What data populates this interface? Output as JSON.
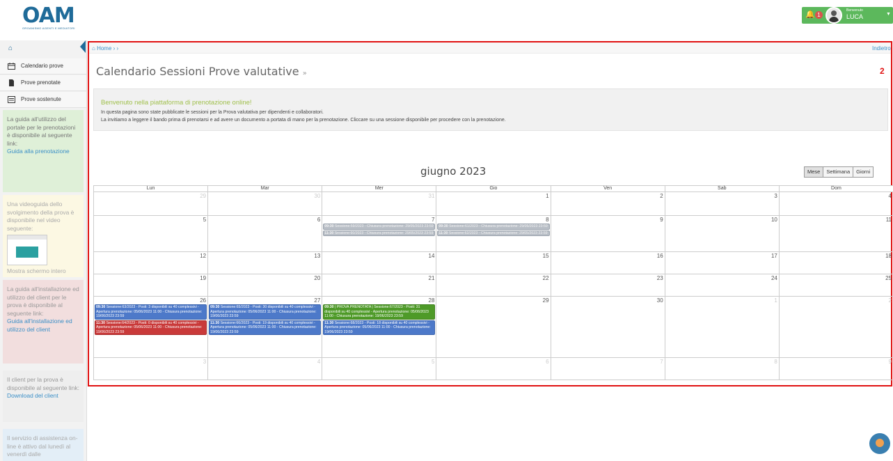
{
  "header": {
    "logo_text": "OAM",
    "logo_subtitle": "ORGANISMO AGENTI E MEDIATORI",
    "notification_count": "1",
    "welcome": "Benvenuto",
    "user_name": "LUCA"
  },
  "sidebar": {
    "items": [
      {
        "label": "Calendario prove"
      },
      {
        "label": "Prove prenotate"
      },
      {
        "label": "Prove sostenute"
      }
    ],
    "panels": {
      "guide_text": "La guida all'utilizzo del portale per le prenotazioni è disponibile al seguente link:",
      "guide_link": "Guida alla prenotazione",
      "video_text": "Una videoguida dello svolgimento della prova è disponibile nel video seguente:",
      "video_link": "Mostra schermo intero",
      "client_guide_text": "La guida all'installazione ed utilizzo del client per le prova è disponibile al seguente link:",
      "client_guide_link": "Guida all'installazione ed utilizzo del client",
      "download_text": "Il client per la prova è disponibile al seguente link:",
      "download_link": "Download del client",
      "assist_text": "Il servizio di assistenza on-line è attivo dal lunedì al venerdì dalle"
    }
  },
  "breadcrumb": {
    "home": "Home",
    "sep": "› ›",
    "back": "Indietro"
  },
  "page": {
    "title": "Calendario Sessioni Prove valutative",
    "title_suffix": "»",
    "marker": "2"
  },
  "info": {
    "heading": "Benvenuto nella piattaforma di prenotazione online!",
    "line1": "In questa pagina sono state pubblicate le sessioni per la Prova valutativa per dipendenti e collaboratori.",
    "line2": "La invitiamo a leggere il bando prima di prenotarsi e ad avere un documento a portata di mano per la prenotazione. Cliccare su una sessione disponibile per procedere con la prenotazione."
  },
  "calendar": {
    "month_label": "giugno 2023",
    "view_buttons": [
      "Mese",
      "Settimana",
      "Giorni"
    ],
    "weekdays": [
      "Lun",
      "Mar",
      "Mer",
      "Gio",
      "Ven",
      "Sab",
      "Dom"
    ],
    "weeks": [
      {
        "days": [
          {
            "n": "29",
            "muted": true,
            "events": []
          },
          {
            "n": "30",
            "muted": true,
            "events": []
          },
          {
            "n": "31",
            "muted": true,
            "events": []
          },
          {
            "n": "1",
            "events": []
          },
          {
            "n": "2",
            "events": []
          },
          {
            "n": "3",
            "events": []
          },
          {
            "n": "4",
            "events": []
          }
        ]
      },
      {
        "days": [
          {
            "n": "5",
            "events": []
          },
          {
            "n": "6",
            "events": []
          },
          {
            "n": "7",
            "events": [
              {
                "time": "09:30",
                "text": "Sessione:59/2023 - Chiusura prenotazione: 29/05/2023 23:59",
                "color": "gray"
              },
              {
                "time": "11:30",
                "text": "Sessione:60/2023 - Chiusura prenotazione: 29/05/2023 23:59",
                "color": "gray"
              }
            ]
          },
          {
            "n": "8",
            "events": [
              {
                "time": "09:30",
                "text": "Sessione:61/2023 - Chiusura prenotazione: 29/05/2023 23:59",
                "color": "gray"
              },
              {
                "time": "11:30",
                "text": "Sessione:62/2023 - Chiusura prenotazione: 29/05/2023 23:59",
                "color": "gray"
              }
            ]
          },
          {
            "n": "9",
            "events": []
          },
          {
            "n": "10",
            "events": []
          },
          {
            "n": "11",
            "events": []
          }
        ]
      },
      {
        "days": [
          {
            "n": "12",
            "events": []
          },
          {
            "n": "13",
            "events": []
          },
          {
            "n": "14",
            "events": []
          },
          {
            "n": "15",
            "events": []
          },
          {
            "n": "16",
            "events": []
          },
          {
            "n": "17",
            "events": []
          },
          {
            "n": "18",
            "events": []
          }
        ]
      },
      {
        "days": [
          {
            "n": "19",
            "events": []
          },
          {
            "n": "20",
            "events": []
          },
          {
            "n": "21",
            "events": []
          },
          {
            "n": "22",
            "events": []
          },
          {
            "n": "23",
            "events": []
          },
          {
            "n": "24",
            "events": []
          },
          {
            "n": "25",
            "events": []
          }
        ]
      },
      {
        "days": [
          {
            "n": "26",
            "events": [
              {
                "time": "09:30",
                "text": "Sessione:63/2023 - Posti: 3 disponibili su 40 complessivi - Apertura prenotazione: 05/06/2023 11:00 - Chiusura prenotazione: 19/06/2023 23:59",
                "color": "blue"
              },
              {
                "time": "11:30",
                "text": "Sessione:64/2023 - Posti: 0 disponibili su 40 complessivi - Apertura prenotazione: 05/06/2023 11:00 - Chiusura prenotazione: 19/06/2023 23:59",
                "color": "red"
              }
            ]
          },
          {
            "n": "27",
            "events": [
              {
                "time": "09:30",
                "text": "Sessione:65/2023 - Posti: 30 disponibili su 40 complessivi - Apertura prenotazione: 05/06/2023 11:00 - Chiusura prenotazione: 19/06/2023 23:59",
                "color": "blue"
              },
              {
                "time": "11:30",
                "text": "Sessione:66/2023 - Posti: 19 disponibili su 40 complessivi - Apertura prenotazione: 05/06/2023 11:00 - Chiusura prenotazione: 19/06/2023 23:59",
                "color": "blue"
              }
            ]
          },
          {
            "n": "28",
            "events": [
              {
                "time": "09:30",
                "text": "| PROVA PRENOTATA | Sessione:67/2023 - Posti: 31 disponibili su 40 complessivi - Apertura prenotazione: 05/06/2023 11:00 - Chiusura prenotazione: 19/06/2023 23:59",
                "color": "green"
              },
              {
                "time": "11:30",
                "text": "Sessione:68/2023 - Posti: 18 disponibili su 40 complessivi - Apertura prenotazione: 05/06/2023 11:00 - Chiusura prenotazione: 19/06/2023 23:59",
                "color": "blue"
              }
            ]
          },
          {
            "n": "29",
            "events": []
          },
          {
            "n": "30",
            "events": []
          },
          {
            "n": "1",
            "muted": true,
            "events": []
          },
          {
            "n": "2",
            "muted": true,
            "events": []
          }
        ]
      },
      {
        "days": [
          {
            "n": "3",
            "muted": true,
            "events": []
          },
          {
            "n": "4",
            "muted": true,
            "events": []
          },
          {
            "n": "5",
            "muted": true,
            "events": []
          },
          {
            "n": "6",
            "muted": true,
            "events": []
          },
          {
            "n": "7",
            "muted": true,
            "events": []
          },
          {
            "n": "8",
            "muted": true,
            "events": []
          },
          {
            "n": "9",
            "muted": true,
            "events": []
          }
        ]
      }
    ]
  },
  "colors": {
    "accent": "#1f6b99",
    "frame": "#e01010",
    "event_blue": "#4d79c9",
    "event_red": "#c93a3a",
    "event_green": "#4e9a28",
    "event_gray": "#b8bec6"
  }
}
